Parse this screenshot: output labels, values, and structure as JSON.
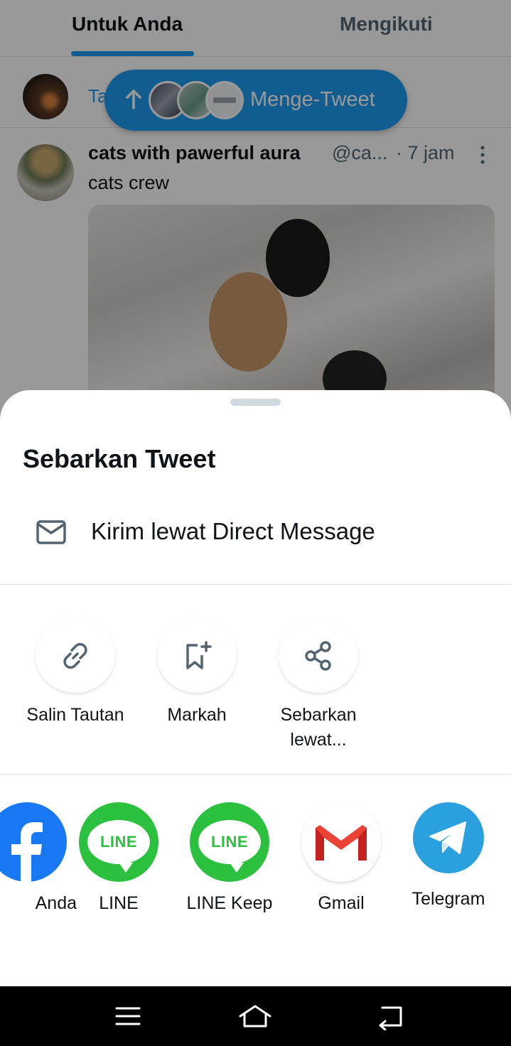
{
  "timeline": {
    "tabs": [
      {
        "label": "Untuk Anda",
        "active": true
      },
      {
        "label": "Mengikuti",
        "active": false
      }
    ],
    "prev_tweet_snippet": "Ta",
    "retweet_pill": {
      "label": "Menge-Tweet"
    },
    "tweet": {
      "name": "cats with pawerful aura",
      "handle": "@ca...",
      "time": "· 7 jam",
      "text": "cats crew"
    }
  },
  "sheet": {
    "title": "Sebarkan Tweet",
    "dm_label": "Kirim lewat Direct Message",
    "actions": [
      {
        "label": "Salin Tautan",
        "icon": "link-icon"
      },
      {
        "label": "Markah",
        "icon": "bookmark-add-icon"
      },
      {
        "label": "Sebarkan lewat...",
        "label_line1": "Sebarkan",
        "label_line2": "lewat...",
        "icon": "share-icon"
      }
    ],
    "apps": [
      {
        "label": "Anda",
        "icon": "facebook-icon"
      },
      {
        "label": "LINE",
        "icon": "line-icon"
      },
      {
        "label": "LINE Keep",
        "icon": "line-keep-icon"
      },
      {
        "label": "Gmail",
        "icon": "gmail-icon"
      },
      {
        "label": "Telegram",
        "icon": "telegram-icon"
      }
    ],
    "line_logo_text": "LINE"
  },
  "colors": {
    "accent": "#1d9bf0",
    "line_green": "#2bc13e",
    "telegram_blue": "#2aa1de",
    "gmail_red": "#ea4335",
    "facebook_blue": "#1877f2"
  }
}
